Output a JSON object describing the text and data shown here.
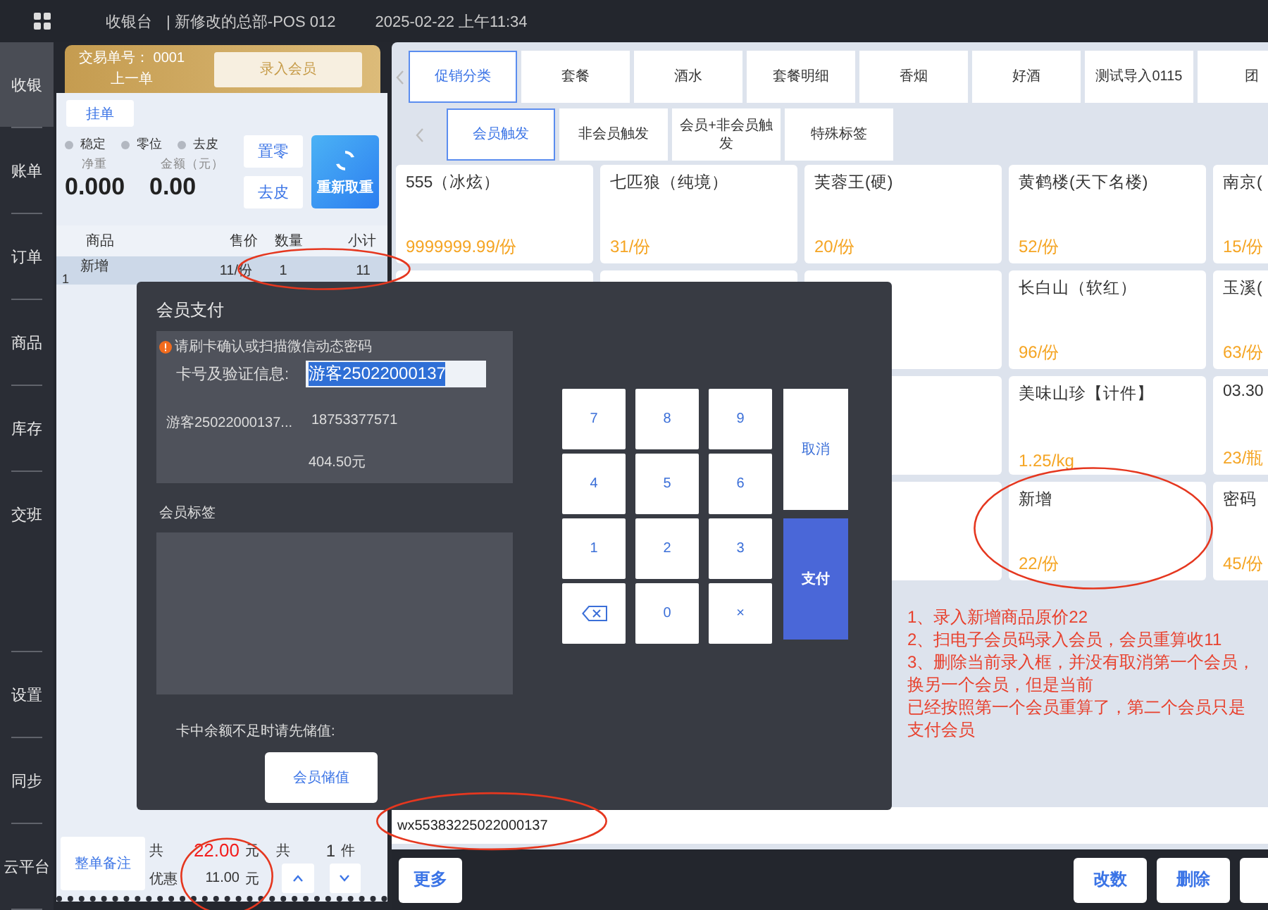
{
  "top_bar": {
    "app_title": "收银台",
    "store": "| 新修改的总部-POS 012",
    "datetime": "2025-02-22 上午11:34"
  },
  "nav_main": [
    {
      "label": "收银",
      "selected": true
    },
    {
      "label": "账单",
      "selected": false
    },
    {
      "label": "订单",
      "selected": false
    },
    {
      "label": "商品",
      "selected": false
    },
    {
      "label": "库存",
      "selected": false
    },
    {
      "label": "交班",
      "selected": false
    }
  ],
  "nav_bottom": [
    {
      "label": "设置",
      "selected": false
    },
    {
      "label": "同步",
      "selected": false
    },
    {
      "label": "云平台",
      "selected": false
    }
  ],
  "order_panel": {
    "trade_no_label": "交易单号：",
    "trade_no": "0001",
    "prev_order": "上一单",
    "member_button": "录入会员",
    "hold_button": "挂单",
    "scale_indicators": [
      {
        "label": "稳定",
        "on": false
      },
      {
        "label": "零位",
        "on": false
      },
      {
        "label": "去皮",
        "on": false
      }
    ],
    "readouts": [
      {
        "label": "净重",
        "value": "0.000"
      },
      {
        "label": "金额（元）",
        "value": "0.00"
      }
    ],
    "zero_button": "置零",
    "tare_button": "去皮",
    "reweigh_button": "重新取重",
    "columns": [
      "商品",
      "售价",
      "数量",
      "小计"
    ],
    "rows": [
      {
        "index": "1",
        "name": "新增",
        "price": "11/份",
        "qty": "1",
        "subtotal": "11",
        "selected": true,
        "circled": true
      }
    ],
    "note_button": "整单备注",
    "totals": {
      "total_label": "共",
      "total": "22.00",
      "total_unit": "元",
      "count_label": "共",
      "count": "1",
      "count_unit": "件",
      "discount_label": "优惠",
      "discount": "11.00",
      "discount_unit": "元",
      "circled": true
    }
  },
  "category_rows": [
    [
      {
        "label": "促销分类",
        "selected": true
      },
      {
        "label": "套餐",
        "selected": false
      },
      {
        "label": "酒水",
        "selected": false
      },
      {
        "label": "套餐明细",
        "selected": false
      },
      {
        "label": "香烟",
        "selected": false
      },
      {
        "label": "好酒",
        "selected": false
      },
      {
        "label": "测试导入0115",
        "selected": false
      },
      {
        "label": "团",
        "selected": false
      }
    ],
    [
      {
        "label": "会员触发",
        "selected": true
      },
      {
        "label": "非会员触发",
        "selected": false
      },
      {
        "label": "会员+非会员触发",
        "selected": false
      },
      {
        "label": "特殊标签",
        "selected": false
      }
    ]
  ],
  "products": [
    [
      {
        "name": "555（冰炫）",
        "price": "9999999.99/份"
      },
      {
        "name": "七匹狼（纯境）",
        "price": "31/份"
      },
      {
        "name": "芙蓉王(硬)",
        "price": "20/份"
      },
      {
        "name": "黄鹤楼(天下名楼)",
        "price": "52/份"
      },
      {
        "name": "南京(",
        "price": "15/份"
      }
    ],
    [
      {
        "name": "长白山（软红）",
        "price": "96/份"
      },
      {
        "name": "玉溪(",
        "price": "63/份"
      }
    ],
    [
      {
        "name": "美味山珍【计件】",
        "price": "1.25/kg"
      },
      {
        "name": "03.30",
        "price": "23/瓶"
      }
    ],
    [
      {
        "name": "新增",
        "price": "22/份",
        "circled": true
      },
      {
        "name": "密码",
        "price": "45/份"
      }
    ]
  ],
  "notes": [
    "1、录入新增商品原价22",
    "2、扫电子会员码录入会员，会员重算收11",
    "3、删除当前录入框，并没有取消第一个会员，换另一个会员，但是当前",
    "已经按照第一个会员重算了，第二个会员只是支付会员"
  ],
  "scan_input": {
    "value": "wx55383225022000137",
    "circled": true
  },
  "bottom_bar": {
    "more_button": "更多",
    "edit_qty_button": "改数",
    "delete_button": "删除"
  },
  "dialog": {
    "title": "会员支付",
    "hint": "请刷卡确认或扫描微信动态密码",
    "card_label": "卡号及验证信息:",
    "card_value": "游客25022000137",
    "member_name": "游客25022000137...",
    "phone": "18753377571",
    "balance": "404.50元",
    "tags_label": "会员标签",
    "low_balance_note": "卡中余额不足时请先储值:",
    "recharge_button": "会员储值",
    "keys": [
      {
        "kind": "digit",
        "label": "7"
      },
      {
        "kind": "digit",
        "label": "8"
      },
      {
        "kind": "digit",
        "label": "9"
      },
      {
        "kind": "digit",
        "label": "4"
      },
      {
        "kind": "digit",
        "label": "5"
      },
      {
        "kind": "digit",
        "label": "6"
      },
      {
        "kind": "digit",
        "label": "1"
      },
      {
        "kind": "digit",
        "label": "2"
      },
      {
        "kind": "digit",
        "label": "3"
      },
      {
        "kind": "backspace"
      },
      {
        "kind": "digit",
        "label": "0"
      },
      {
        "kind": "clear",
        "label": "×"
      }
    ],
    "cancel_button": "取消",
    "pay_button": "支付"
  }
}
